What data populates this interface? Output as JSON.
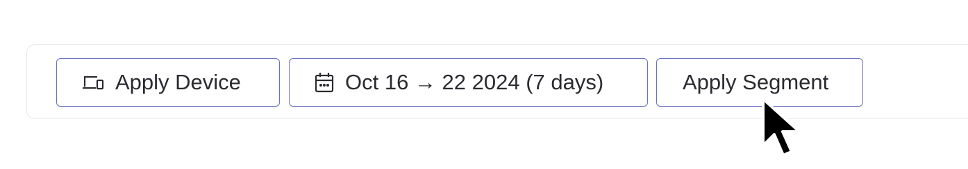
{
  "toolbar": {
    "device_label": "Apply Device",
    "device_icon": "devices-icon",
    "date_label": "Oct 16 → 22 2024 (7 days)",
    "date_icon": "calendar-icon",
    "segment_label": "Apply Segment"
  },
  "colors": {
    "button_border": "#6b6fc6",
    "text": "#2a2a30",
    "panel_border": "#e8e8ec"
  }
}
